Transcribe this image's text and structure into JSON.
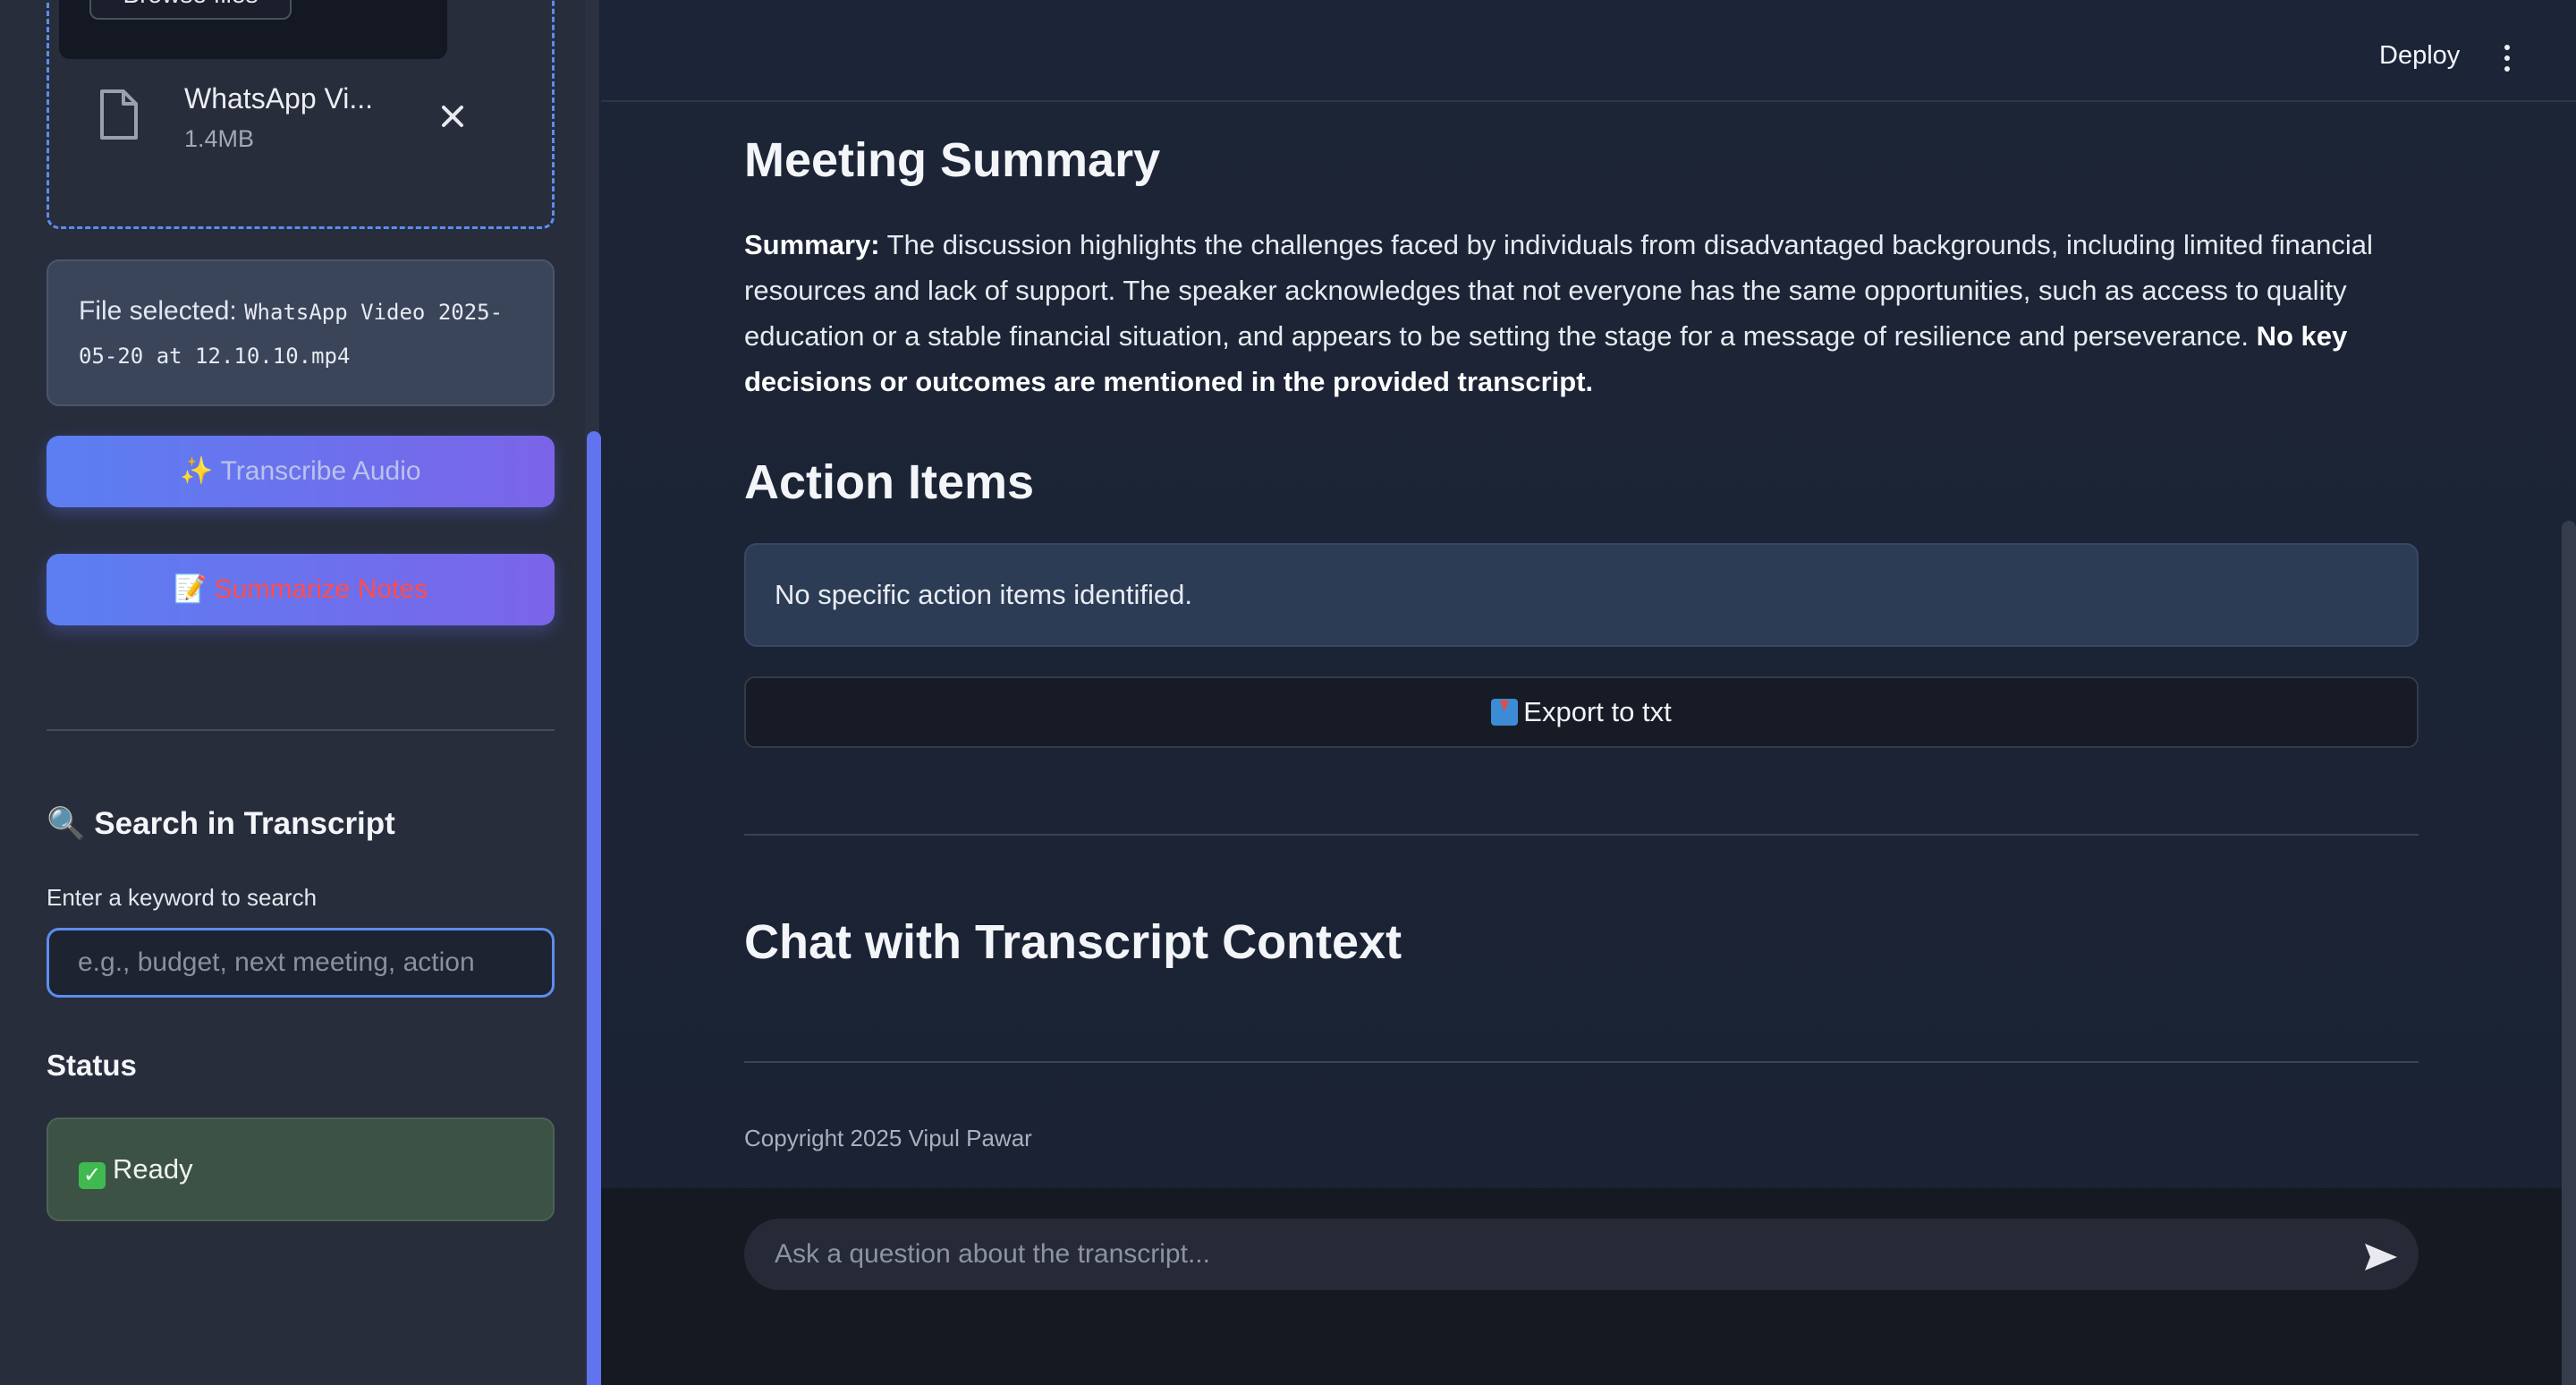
{
  "sidebar": {
    "uploader": {
      "browse_label": "Browse files",
      "file_name": "WhatsApp Vi...",
      "file_size": "1.4MB"
    },
    "file_selected": {
      "label": "File selected:",
      "value": "WhatsApp Video 2025-05-20 at 12.10.10.mp4"
    },
    "transcribe_label": "✨ Transcribe Audio",
    "summarize_label": "📝 Summarize Notes",
    "search": {
      "heading": "🔍 Search in Transcript",
      "label": "Enter a keyword to search",
      "placeholder": "e.g., budget, next meeting, action"
    },
    "status": {
      "heading": "Status",
      "value": "Ready"
    }
  },
  "header": {
    "deploy_label": "Deploy"
  },
  "main": {
    "meeting_summary_heading": "Meeting Summary",
    "summary_label": "Summary:",
    "summary_text": " The discussion highlights the challenges faced by individuals from disadvantaged backgrounds, including limited financial resources and lack of support. The speaker acknowledges that not everyone has the same opportunities, such as access to quality education or a stable financial situation, and appears to be setting the stage for a message of resilience and perseverance. ",
    "summary_bold_tail": "No key decisions or outcomes are mentioned in the provided transcript.",
    "action_items_heading": "Action Items",
    "action_items_info": "No specific action items identified.",
    "export_label": "Export to txt",
    "chat_heading": "Chat with Transcript Context",
    "copyright": "Copyright 2025 Vipul Pawar",
    "chat_placeholder": "Ask a question about the transcript..."
  },
  "colors": {
    "accent_blue": "#5b8def",
    "gradient_start": "#5b7ff2",
    "gradient_end": "#7b64e8",
    "summarize_text": "#ff4d4d",
    "status_success_bg": "#3c5244"
  },
  "icons": [
    "file-icon",
    "close-icon",
    "magnifier-icon",
    "check-icon",
    "inbox-tray-icon",
    "kebab-menu-icon",
    "send-icon"
  ]
}
